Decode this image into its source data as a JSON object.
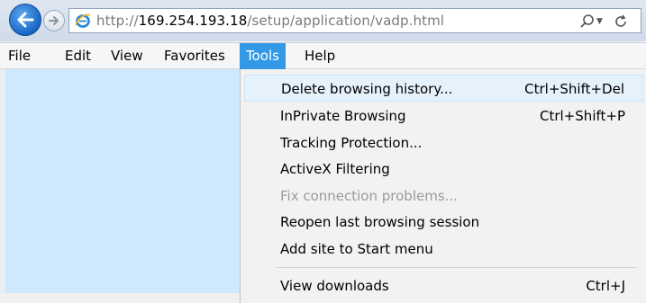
{
  "address_bar": {
    "url_prefix": "http://",
    "url_host": "169.254.193.18",
    "url_path": "/setup/application/vadp.html"
  },
  "menubar": {
    "items": [
      "File",
      "Edit",
      "View",
      "Favorites",
      "Tools",
      "Help"
    ],
    "active": "Tools"
  },
  "tools_menu": {
    "items": [
      {
        "label": "Delete browsing history...",
        "shortcut": "Ctrl+Shift+Del",
        "state": "hover"
      },
      {
        "label": "InPrivate Browsing",
        "shortcut": "Ctrl+Shift+P",
        "state": "normal"
      },
      {
        "label": "Tracking Protection...",
        "shortcut": "",
        "state": "normal"
      },
      {
        "label": "ActiveX Filtering",
        "shortcut": "",
        "state": "normal"
      },
      {
        "label": "Fix connection problems...",
        "shortcut": "",
        "state": "disabled"
      },
      {
        "label": "Reopen last browsing session",
        "shortcut": "",
        "state": "normal"
      },
      {
        "label": "Add site to Start menu",
        "shortcut": "",
        "state": "normal"
      },
      {
        "label": "View downloads",
        "shortcut": "Ctrl+J",
        "state": "normal"
      }
    ]
  },
  "colors": {
    "menu_active_bg": "#3399e6",
    "hover_bg": "#e5f1fb",
    "page_bg": "#cfe8fb",
    "disabled_text": "#9a9a9a"
  },
  "icons": {
    "back": "back-arrow-icon",
    "forward": "forward-arrow-icon",
    "site": "ie-logo-icon",
    "search": "search-icon",
    "dropdown": "dropdown-arrow-icon",
    "refresh": "refresh-icon"
  }
}
